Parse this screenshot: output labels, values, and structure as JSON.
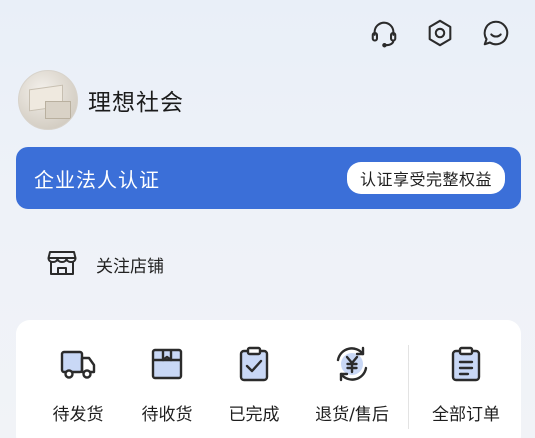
{
  "header": {
    "icons": [
      "headset-icon",
      "settings-hexagon-icon",
      "chat-bubble-icon"
    ]
  },
  "profile": {
    "name": "理想社会"
  },
  "banner": {
    "title": "企业法人认证",
    "button_label": "认证享受完整权益",
    "color": "#3b6fd8"
  },
  "follow": {
    "label": "关注店铺"
  },
  "orders": {
    "items": [
      {
        "label": "待发货",
        "icon": "truck-icon"
      },
      {
        "label": "待收货",
        "icon": "package-icon"
      },
      {
        "label": "已完成",
        "icon": "clipboard-check-icon"
      },
      {
        "label": "退货/售后",
        "icon": "refund-yen-icon"
      },
      {
        "label": "全部订单",
        "icon": "clipboard-list-icon"
      }
    ]
  }
}
